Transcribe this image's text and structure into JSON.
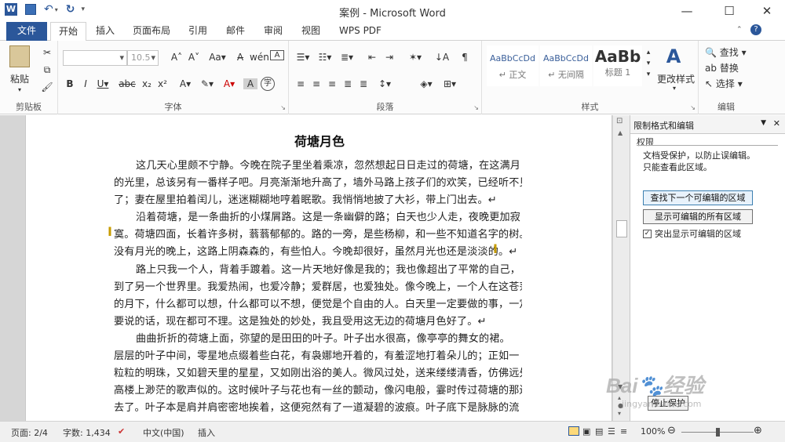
{
  "window": {
    "title": "案例 - Microsoft Word",
    "help_glyph": "?",
    "minimize_glyph": "—",
    "maximize_glyph": "☐",
    "close_glyph": "✕"
  },
  "quick_access": {
    "word_icon": "W",
    "undo_glyph": "↶",
    "redo_glyph": "↻"
  },
  "tabs": [
    {
      "label": "文件"
    },
    {
      "label": "开始"
    },
    {
      "label": "插入"
    },
    {
      "label": "页面布局"
    },
    {
      "label": "引用"
    },
    {
      "label": "邮件"
    },
    {
      "label": "审阅"
    },
    {
      "label": "视图"
    },
    {
      "label": "WPS PDF"
    }
  ],
  "ribbon": {
    "clipboard": {
      "label": "剪贴板",
      "paste": "粘贴"
    },
    "font": {
      "label": "字体",
      "font_size": "10.5"
    },
    "paragraph": {
      "label": "段落"
    },
    "styles": {
      "label": "样式",
      "items": [
        {
          "sample": "AaBbCcDd",
          "name": "↵ 正文"
        },
        {
          "sample": "AaBbCcDd",
          "name": "↵ 无间隔"
        },
        {
          "sample": "AaBb",
          "name": "标题 1"
        }
      ],
      "change_styles": "更改样式"
    },
    "editing": {
      "label": "编辑",
      "find": "查找",
      "replace": "替换",
      "select": "选择"
    }
  },
  "document": {
    "title": "荷塘月色",
    "lines": [
      {
        "text": "这几天心里颇不宁静。今晚在院子里坐着乘凉，忽然想起日日走过的荷塘，在这满月",
        "indent": true
      },
      {
        "text": "的光里，总该另有一番样子吧。月亮渐渐地升高了，墙外马路上孩子们的欢笑，已经听不见",
        "indent": false
      },
      {
        "text": "了；妻在屋里拍着闰儿，迷迷糊糊地哼着眠歌。我悄悄地披了大衫，带上门出去。↵",
        "indent": false
      },
      {
        "text": "沿着荷塘，是一条曲折的小煤屑路。这是一条幽僻的路；白天也少人走，夜晚更加寂",
        "indent": true
      },
      {
        "text": "寞。荷塘四面，长着许多树，蓊蓊郁郁的。路的一旁，是些杨柳，和一些不知道名字的树。",
        "indent": false
      },
      {
        "text": "没有月光的晚上，这路上阴森森的，有些怕人。今晚却很好，虽然月光也还是淡淡的。↵",
        "indent": false
      },
      {
        "text": "路上只我一个人，背着手踱着。这一片天地好像是我的；我也像超出了平常的自己，",
        "indent": true
      },
      {
        "text": "到了另一个世界里。我爱热闹，也爱冷静；爱群居，也爱独处。像今晚上，一个人在这苍茫",
        "indent": false
      },
      {
        "text": "的月下，什么都可以想，什么都可以不想，便觉是个自由的人。白天里一定要做的事，一定",
        "indent": false
      },
      {
        "text": "要说的话，现在都可不理。这是独处的妙处，我且受用这无边的荷塘月色好了。↵",
        "indent": false
      },
      {
        "text": "曲曲折折的荷塘上面，弥望的是田田的叶子。叶子出水很高，像亭亭的舞女的裙。",
        "indent": true
      },
      {
        "text": "层层的叶子中间，零星地点缀着些白花，有袅娜地开着的，有羞涩地打着朵儿的；正如一",
        "indent": false
      },
      {
        "text": "粒粒的明珠，又如碧天里的星星，又如刚出浴的美人。微风过处，送来缕缕清香，仿佛远处",
        "indent": false
      },
      {
        "text": "高楼上渺茫的歌声似的。这时候叶子与花也有一丝的颤动，像闪电般，霎时传过荷塘的那边",
        "indent": false
      },
      {
        "text": "去了。叶子本是肩并肩密密地挨着，这便宛然有了一道凝碧的波痕。叶子底下是脉脉的流",
        "indent": false
      }
    ]
  },
  "task_pane": {
    "title": "限制格式和编辑",
    "section": "权限",
    "message_line1": "文档受保护，以防止误编辑。",
    "message_line2": "只能查看此区域。",
    "find_next_btn": "查找下一个可编辑的区域",
    "show_all_btn": "显示可编辑的所有区域",
    "highlight_label": "突出显示可编辑的区域",
    "highlight_checked": true,
    "stop_protection_btn": "停止保护"
  },
  "statusbar": {
    "page": "页面: 2/4",
    "words": "字数: 1,434",
    "language": "中文(中国)",
    "mode": "插入",
    "zoom": "100%",
    "zoom_fraction": 0.5
  },
  "watermark": {
    "brand": "Bai",
    "brand_cn": "经验",
    "url": "jingyan.baidu.com"
  }
}
